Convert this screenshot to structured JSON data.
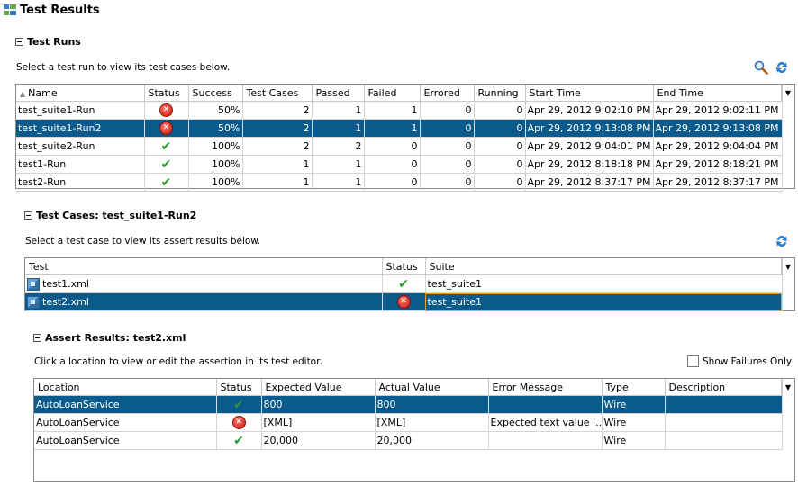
{
  "page": {
    "title": "Test Results"
  },
  "runs": {
    "section_title": "Test Runs",
    "description": "Select a test run to view its test cases below.",
    "columns": [
      "Name",
      "Status",
      "Success",
      "Test Cases",
      "Passed",
      "Failed",
      "Errored",
      "Running",
      "Start Time",
      "End Time"
    ],
    "rows": [
      {
        "name": "test_suite1-Run",
        "status": "error",
        "success": "50%",
        "test_cases": "2",
        "passed": "1",
        "failed": "1",
        "errored": "0",
        "running": "0",
        "start": "Apr 29, 2012 9:02:10 PM",
        "end": "Apr 29, 2012 9:02:11 PM"
      },
      {
        "name": "test_suite1-Run2",
        "status": "error",
        "success": "50%",
        "test_cases": "2",
        "passed": "1",
        "failed": "1",
        "errored": "0",
        "running": "0",
        "start": "Apr 29, 2012 9:13:08 PM",
        "end": "Apr 29, 2012 9:13:08 PM"
      },
      {
        "name": "test_suite2-Run",
        "status": "ok",
        "success": "100%",
        "test_cases": "2",
        "passed": "2",
        "failed": "0",
        "errored": "0",
        "running": "0",
        "start": "Apr 29, 2012 9:04:01 PM",
        "end": "Apr 29, 2012 9:04:04 PM"
      },
      {
        "name": "test1-Run",
        "status": "ok",
        "success": "100%",
        "test_cases": "1",
        "passed": "1",
        "failed": "0",
        "errored": "0",
        "running": "0",
        "start": "Apr 29, 2012 8:18:18 PM",
        "end": "Apr 29, 2012 8:18:21 PM"
      },
      {
        "name": "test2-Run",
        "status": "ok",
        "success": "100%",
        "test_cases": "1",
        "passed": "1",
        "failed": "0",
        "errored": "0",
        "running": "0",
        "start": "Apr 29, 2012 8:37:17 PM",
        "end": "Apr 29, 2012 8:37:17 PM"
      }
    ]
  },
  "cases": {
    "section_title": "Test Cases: test_suite1-Run2",
    "description": "Select a test case to view its assert results below.",
    "columns": [
      "Test",
      "Status",
      "Suite"
    ],
    "rows": [
      {
        "test": "test1.xml",
        "status": "ok",
        "suite": "test_suite1"
      },
      {
        "test": "test2.xml",
        "status": "error",
        "suite": "test_suite1"
      }
    ]
  },
  "asserts": {
    "section_title": "Assert Results: test2.xml",
    "description": "Click a location to view or edit the assertion in its test editor.",
    "show_failures_label": "Show Failures Only",
    "columns": [
      "Location",
      "Status",
      "Expected Value",
      "Actual Value",
      "Error Message",
      "Type",
      "Description"
    ],
    "rows": [
      {
        "location": "AutoLoanService",
        "status": "ok",
        "expected": "800",
        "actual": "800",
        "error": "",
        "type": "Wire",
        "description": ""
      },
      {
        "location": "AutoLoanService",
        "status": "error",
        "expected": "[XML]",
        "actual": "[XML]",
        "error": "Expected text value '...",
        "type": "Wire",
        "description": ""
      },
      {
        "location": "AutoLoanService",
        "status": "ok",
        "expected": "20,000",
        "actual": "20,000",
        "error": "",
        "type": "Wire",
        "description": ""
      }
    ]
  },
  "icons": {
    "search": "search-icon",
    "refresh": "refresh-icon",
    "error": "error-icon",
    "ok": "checkmark-icon",
    "file": "xml-test-file-icon"
  }
}
